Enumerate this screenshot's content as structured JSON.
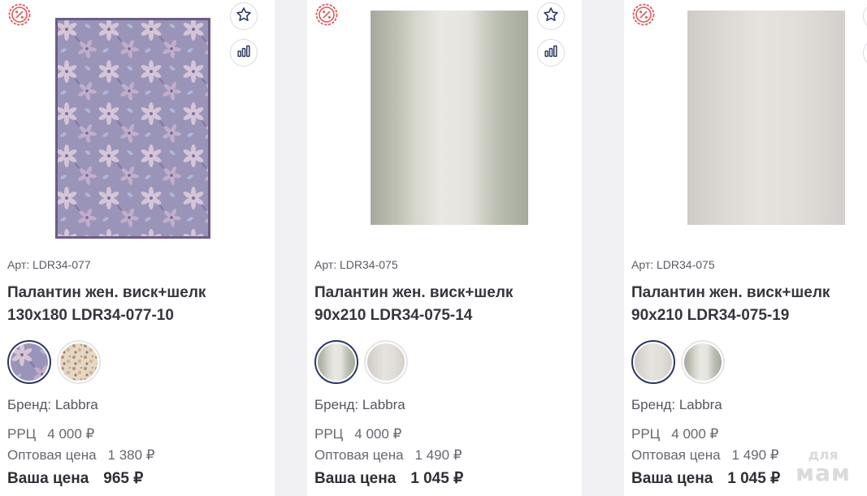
{
  "colors": {
    "sale_badge": "#e2595a",
    "icon": "#2c3760",
    "swatch_active_border": "#2c3760",
    "background": "#f1f1f3"
  },
  "icons": {
    "sale": "percent-badge-icon",
    "favorite": "star-icon",
    "compare": "bar-chart-icon"
  },
  "products": [
    {
      "article": "Арт: LDR34-077",
      "title_line1": "Палантин жен. виск+шелк",
      "title_line2": "130х180 LDR34-077-10",
      "brand": "Бренд: Labbra",
      "rrp_label": "РРЦ",
      "rrp_value": "4 000 ₽",
      "wholesale_label": "Оптовая цена",
      "wholesale_value": "1 380 ₽",
      "your_price_label": "Ваша цена",
      "your_price_value": "965 ₽"
    },
    {
      "article": "Арт: LDR34-075",
      "title_line1": "Палантин жен. виск+шелк",
      "title_line2": "90х210 LDR34-075-14",
      "brand": "Бренд: Labbra",
      "rrp_label": "РРЦ",
      "rrp_value": "4 000 ₽",
      "wholesale_label": "Оптовая цена",
      "wholesale_value": "1 490 ₽",
      "your_price_label": "Ваша цена",
      "your_price_value": "1 045 ₽"
    },
    {
      "article": "Арт: LDR34-075",
      "title_line1": "Палантин жен. виск+шелк",
      "title_line2": "90х210 LDR34-075-19",
      "brand": "Бренд: Labbra",
      "rrp_label": "РРЦ",
      "rrp_value": "4 000 ₽",
      "wholesale_label": "Оптовая цена",
      "wholesale_value": "1 490 ₽",
      "your_price_label": "Ваша цена",
      "your_price_value": "1 045 ₽"
    }
  ],
  "watermark": {
    "line1": "для",
    "line2": "мам"
  }
}
